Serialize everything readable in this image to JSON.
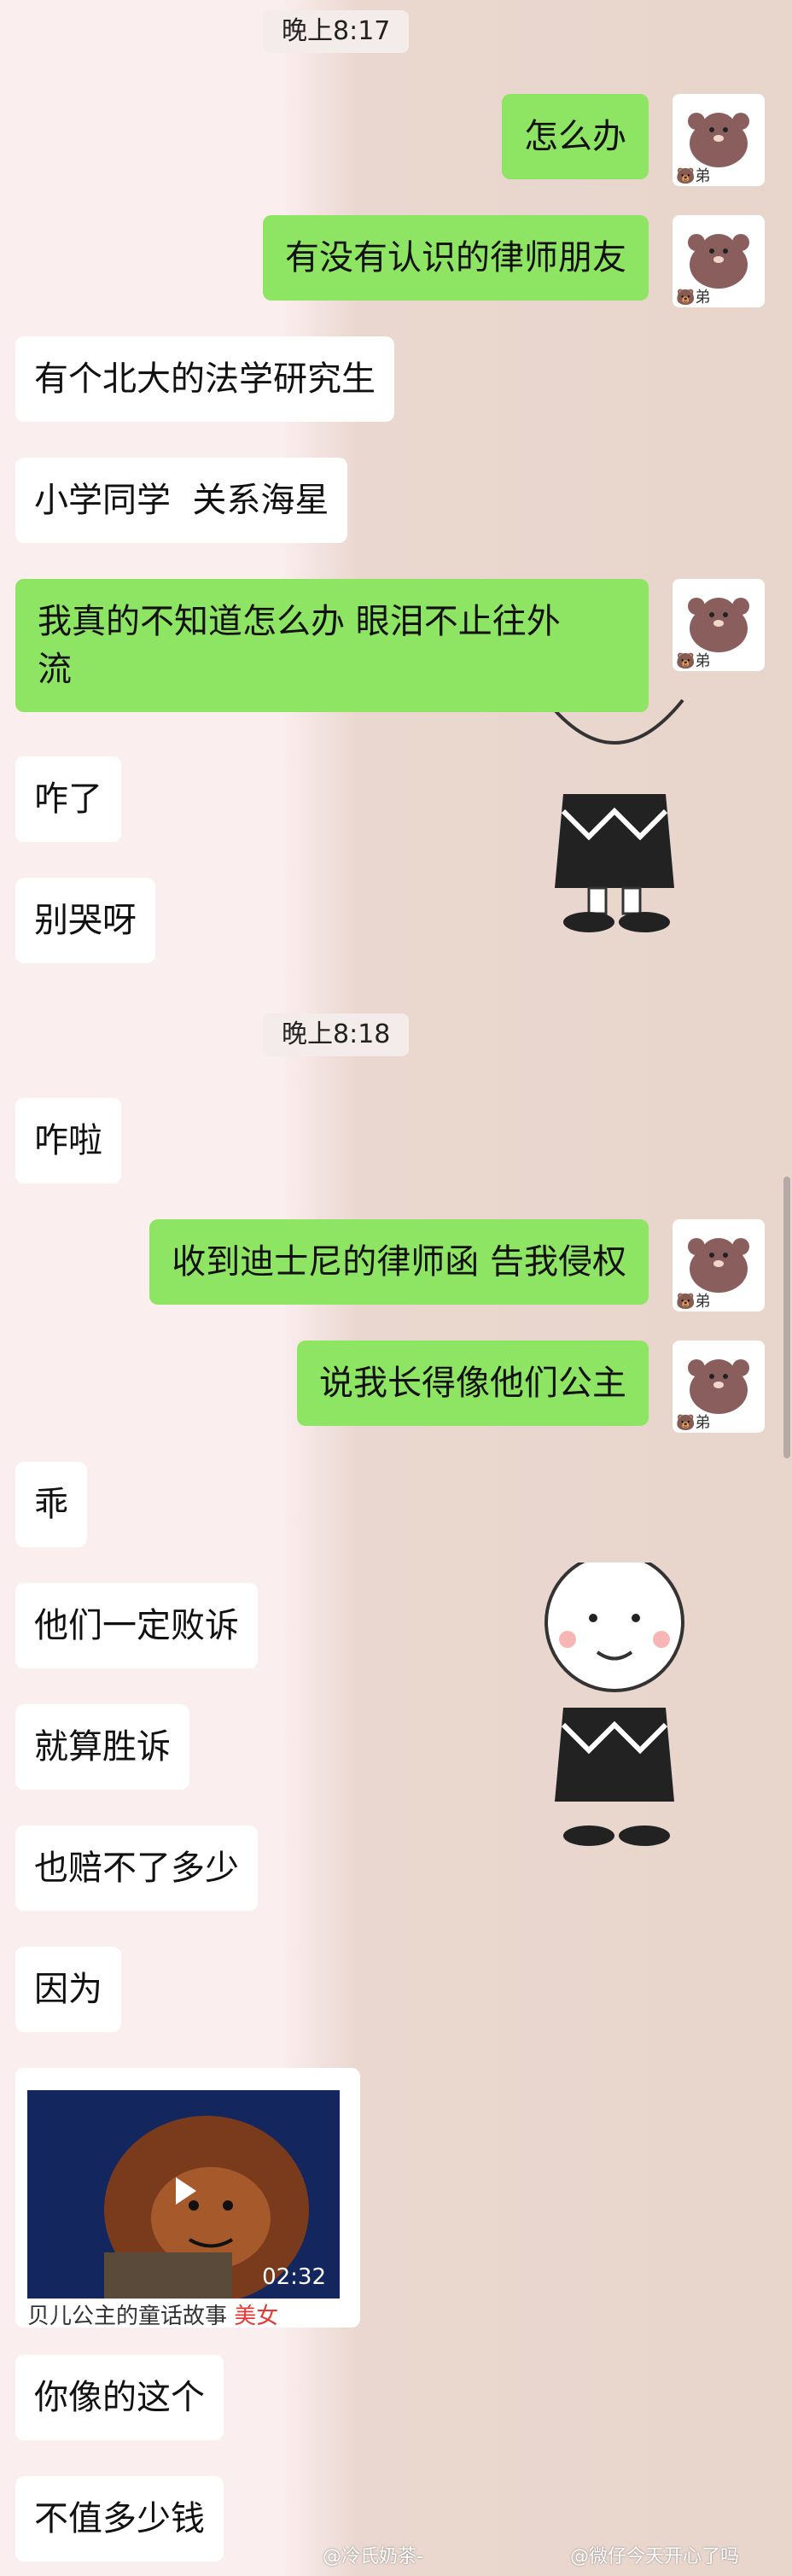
{
  "timestamps": [
    "晚上8:17",
    "晚上8:18"
  ],
  "contact_tag": "弟",
  "messages": [
    {
      "side": "right",
      "text": "怎么办"
    },
    {
      "side": "right",
      "text": "有没有认识的律师朋友"
    },
    {
      "side": "left",
      "text": "有个北大的法学研究生"
    },
    {
      "side": "left",
      "text": "小学同学  关系海星"
    },
    {
      "side": "right",
      "text": "我真的不知道怎么办 眼泪不止往外\n流"
    },
    {
      "side": "left",
      "text": "咋了"
    },
    {
      "side": "left",
      "text": "别哭呀"
    },
    {
      "side": "left",
      "text": "咋啦"
    },
    {
      "side": "right",
      "text": "收到迪士尼的律师函 告我侵权"
    },
    {
      "side": "right",
      "text": "说我长得像他们公主"
    },
    {
      "side": "left",
      "text": "乖"
    },
    {
      "side": "left",
      "text": "他们一定败诉"
    },
    {
      "side": "left",
      "text": "就算胜诉"
    },
    {
      "side": "left",
      "text": "也赔不了多少"
    },
    {
      "side": "left",
      "text": "因为"
    },
    {
      "side": "left",
      "text": "你像的这个"
    },
    {
      "side": "left",
      "text": "不值多少钱"
    }
  ],
  "video": {
    "duration": "02:32",
    "title_prefix": "贝儿公主的童话故事 ",
    "title_highlight": "美女"
  },
  "watermarks": {
    "left": "@冷氏奶茶-",
    "right": "@微仔今天开心了吗"
  },
  "colors": {
    "right_bubble": "#8ee463",
    "left_bubble": "#ffffff",
    "background_left": "#fbeeef",
    "background_right": "#e8d6cc"
  }
}
